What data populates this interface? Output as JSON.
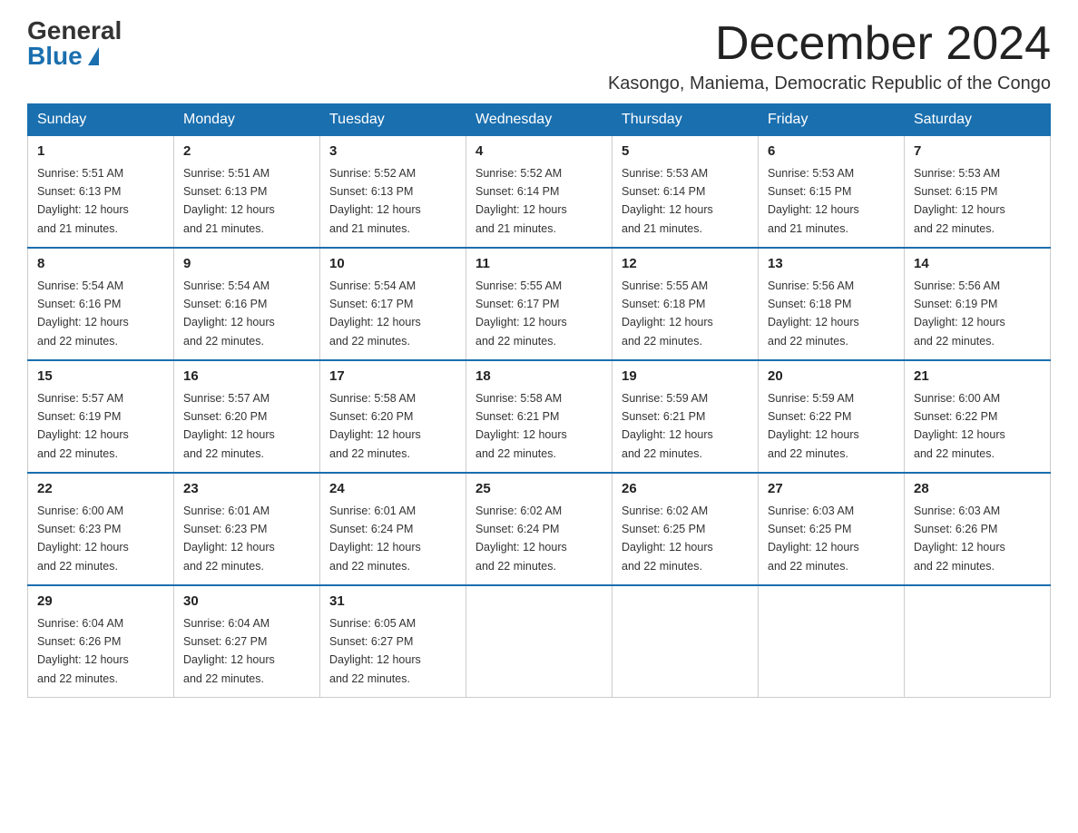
{
  "header": {
    "logo_general": "General",
    "logo_blue": "Blue",
    "month_title": "December 2024",
    "location": "Kasongo, Maniema, Democratic Republic of the Congo"
  },
  "days_of_week": [
    "Sunday",
    "Monday",
    "Tuesday",
    "Wednesday",
    "Thursday",
    "Friday",
    "Saturday"
  ],
  "weeks": [
    [
      {
        "day": "1",
        "sunrise": "5:51 AM",
        "sunset": "6:13 PM",
        "daylight": "12 hours and 21 minutes."
      },
      {
        "day": "2",
        "sunrise": "5:51 AM",
        "sunset": "6:13 PM",
        "daylight": "12 hours and 21 minutes."
      },
      {
        "day": "3",
        "sunrise": "5:52 AM",
        "sunset": "6:13 PM",
        "daylight": "12 hours and 21 minutes."
      },
      {
        "day": "4",
        "sunrise": "5:52 AM",
        "sunset": "6:14 PM",
        "daylight": "12 hours and 21 minutes."
      },
      {
        "day": "5",
        "sunrise": "5:53 AM",
        "sunset": "6:14 PM",
        "daylight": "12 hours and 21 minutes."
      },
      {
        "day": "6",
        "sunrise": "5:53 AM",
        "sunset": "6:15 PM",
        "daylight": "12 hours and 21 minutes."
      },
      {
        "day": "7",
        "sunrise": "5:53 AM",
        "sunset": "6:15 PM",
        "daylight": "12 hours and 22 minutes."
      }
    ],
    [
      {
        "day": "8",
        "sunrise": "5:54 AM",
        "sunset": "6:16 PM",
        "daylight": "12 hours and 22 minutes."
      },
      {
        "day": "9",
        "sunrise": "5:54 AM",
        "sunset": "6:16 PM",
        "daylight": "12 hours and 22 minutes."
      },
      {
        "day": "10",
        "sunrise": "5:54 AM",
        "sunset": "6:17 PM",
        "daylight": "12 hours and 22 minutes."
      },
      {
        "day": "11",
        "sunrise": "5:55 AM",
        "sunset": "6:17 PM",
        "daylight": "12 hours and 22 minutes."
      },
      {
        "day": "12",
        "sunrise": "5:55 AM",
        "sunset": "6:18 PM",
        "daylight": "12 hours and 22 minutes."
      },
      {
        "day": "13",
        "sunrise": "5:56 AM",
        "sunset": "6:18 PM",
        "daylight": "12 hours and 22 minutes."
      },
      {
        "day": "14",
        "sunrise": "5:56 AM",
        "sunset": "6:19 PM",
        "daylight": "12 hours and 22 minutes."
      }
    ],
    [
      {
        "day": "15",
        "sunrise": "5:57 AM",
        "sunset": "6:19 PM",
        "daylight": "12 hours and 22 minutes."
      },
      {
        "day": "16",
        "sunrise": "5:57 AM",
        "sunset": "6:20 PM",
        "daylight": "12 hours and 22 minutes."
      },
      {
        "day": "17",
        "sunrise": "5:58 AM",
        "sunset": "6:20 PM",
        "daylight": "12 hours and 22 minutes."
      },
      {
        "day": "18",
        "sunrise": "5:58 AM",
        "sunset": "6:21 PM",
        "daylight": "12 hours and 22 minutes."
      },
      {
        "day": "19",
        "sunrise": "5:59 AM",
        "sunset": "6:21 PM",
        "daylight": "12 hours and 22 minutes."
      },
      {
        "day": "20",
        "sunrise": "5:59 AM",
        "sunset": "6:22 PM",
        "daylight": "12 hours and 22 minutes."
      },
      {
        "day": "21",
        "sunrise": "6:00 AM",
        "sunset": "6:22 PM",
        "daylight": "12 hours and 22 minutes."
      }
    ],
    [
      {
        "day": "22",
        "sunrise": "6:00 AM",
        "sunset": "6:23 PM",
        "daylight": "12 hours and 22 minutes."
      },
      {
        "day": "23",
        "sunrise": "6:01 AM",
        "sunset": "6:23 PM",
        "daylight": "12 hours and 22 minutes."
      },
      {
        "day": "24",
        "sunrise": "6:01 AM",
        "sunset": "6:24 PM",
        "daylight": "12 hours and 22 minutes."
      },
      {
        "day": "25",
        "sunrise": "6:02 AM",
        "sunset": "6:24 PM",
        "daylight": "12 hours and 22 minutes."
      },
      {
        "day": "26",
        "sunrise": "6:02 AM",
        "sunset": "6:25 PM",
        "daylight": "12 hours and 22 minutes."
      },
      {
        "day": "27",
        "sunrise": "6:03 AM",
        "sunset": "6:25 PM",
        "daylight": "12 hours and 22 minutes."
      },
      {
        "day": "28",
        "sunrise": "6:03 AM",
        "sunset": "6:26 PM",
        "daylight": "12 hours and 22 minutes."
      }
    ],
    [
      {
        "day": "29",
        "sunrise": "6:04 AM",
        "sunset": "6:26 PM",
        "daylight": "12 hours and 22 minutes."
      },
      {
        "day": "30",
        "sunrise": "6:04 AM",
        "sunset": "6:27 PM",
        "daylight": "12 hours and 22 minutes."
      },
      {
        "day": "31",
        "sunrise": "6:05 AM",
        "sunset": "6:27 PM",
        "daylight": "12 hours and 22 minutes."
      },
      null,
      null,
      null,
      null
    ]
  ],
  "labels": {
    "sunrise": "Sunrise:",
    "sunset": "Sunset:",
    "daylight": "Daylight:"
  }
}
